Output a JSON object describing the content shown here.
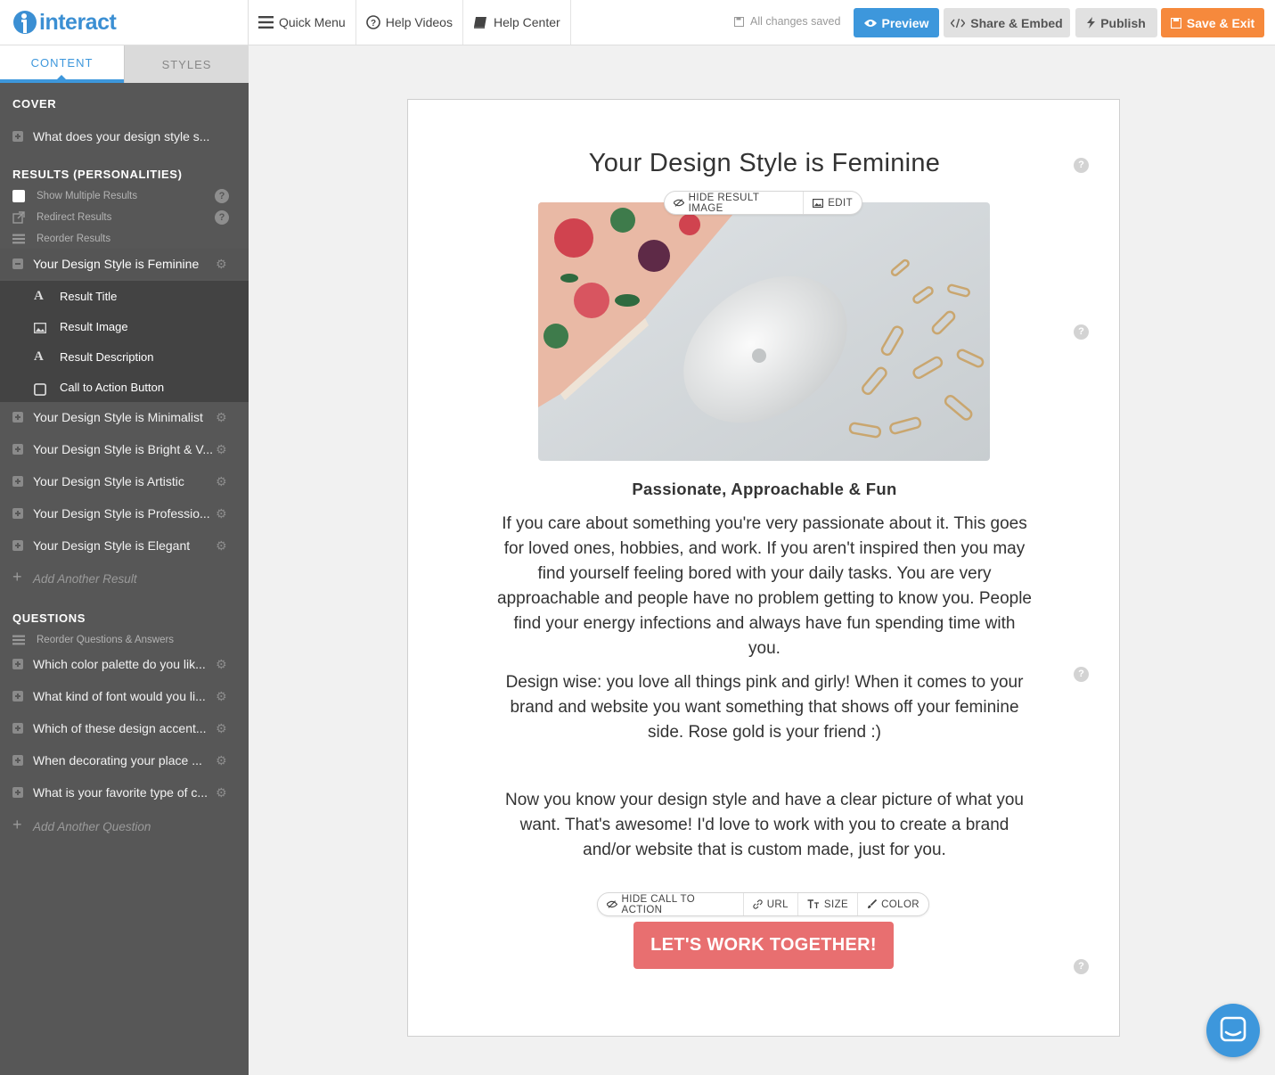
{
  "app": {
    "logo_text": "interact"
  },
  "topnav": [
    {
      "label": "Quick Menu",
      "icon": "hamburger-icon"
    },
    {
      "label": "Help Videos",
      "icon": "question-circle-icon"
    },
    {
      "label": "Help Center",
      "icon": "book-icon"
    }
  ],
  "status": {
    "saved": "All changes saved"
  },
  "actions": {
    "preview": "Preview",
    "share": "Share & Embed",
    "publish": "Publish",
    "save_exit": "Save & Exit"
  },
  "sidebar": {
    "tabs": {
      "content": "CONTENT",
      "styles": "STYLES"
    },
    "cover_title": "COVER",
    "cover_item": "What does your design style s...",
    "results_title": "RESULTS (PERSONALITIES)",
    "options": {
      "show_multiple": "Show Multiple Results",
      "redirect": "Redirect Results",
      "reorder": "Reorder Results"
    },
    "active_result": "Your Design Style is Feminine",
    "sub_items": {
      "title": "Result Title",
      "image": "Result Image",
      "description": "Result Description",
      "cta": "Call to Action Button"
    },
    "results": [
      "Your Design Style is Minimalist",
      "Your Design Style is Bright & V...",
      "Your Design Style is Artistic",
      "Your Design Style is Professio...",
      "Your Design Style is Elegant"
    ],
    "add_result": "Add Another Result",
    "questions_title": "QUESTIONS",
    "reorder_questions": "Reorder Questions & Answers",
    "questions": [
      "Which color palette do you lik...",
      "What kind of font would you li...",
      "Which of these design accent...",
      "When decorating your place ...",
      "What is your favorite type of c..."
    ],
    "add_question": "Add Another Question"
  },
  "result": {
    "title": "Your Design Style is Feminine",
    "image_toolbar": {
      "hide": "HIDE RESULT IMAGE",
      "edit": "EDIT"
    },
    "subheading": "Passionate, Approachable & Fun",
    "paragraph1": "If you care about something you're very passionate about it. This goes for loved ones, hobbies, and work. If you aren't inspired then you may find yourself feeling bored with your daily tasks. You are very approachable and people have no problem getting to know you. People find your energy infections and always have fun spending time with you.",
    "paragraph2": "Design wise: you love all things pink and girly! When it comes to your brand and website you want something that shows off your feminine side. Rose gold is your friend :)",
    "paragraph3": "Now you know your design style and have a clear picture of what you want. That's awesome! I'd love to work with you to create a brand and/or website that is custom made, just for you.",
    "cta_toolbar": {
      "hide": "HIDE CALL TO ACTION",
      "url": "URL",
      "size": "SIZE",
      "color": "COLOR"
    },
    "cta_label": "LET'S WORK TOGETHER!"
  },
  "colors": {
    "accent_blue": "#3d97dc",
    "save_orange": "#f6893c",
    "cta_pink": "#e86f70",
    "sidebar_bg": "#575757"
  }
}
